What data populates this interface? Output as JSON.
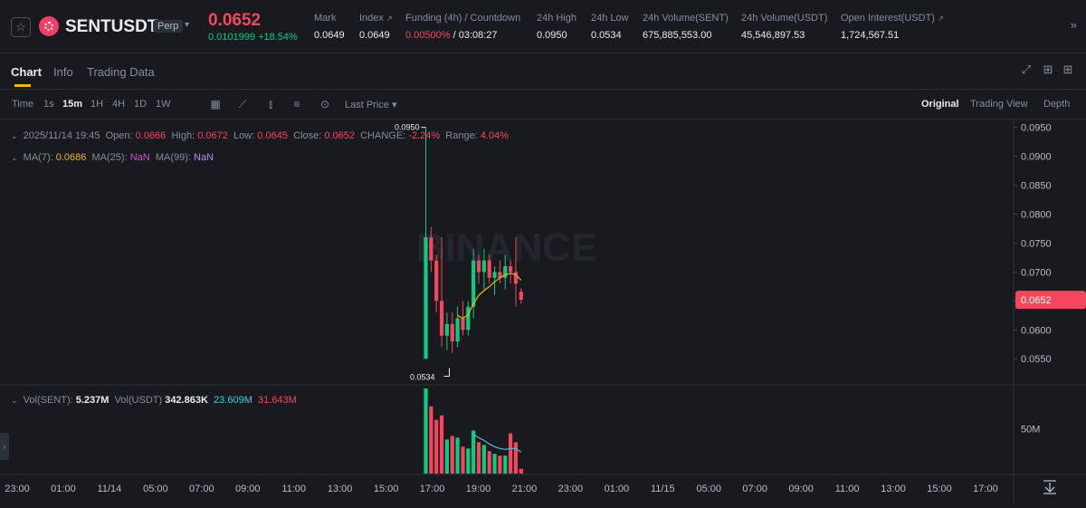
{
  "header": {
    "symbol": "SENTUSDT",
    "contract_type": "Perp",
    "last_price": "0.0652",
    "change_abs": "0.0101999",
    "change_pct": "+18.54%",
    "stats": [
      {
        "label": "Mark",
        "value": "0.0649"
      },
      {
        "label": "Index",
        "value": "0.0649"
      },
      {
        "label": "Funding (4h) / Countdown",
        "value": "0.00500%",
        "value2": "/ 03:08:27"
      },
      {
        "label": "24h High",
        "value": "0.0950"
      },
      {
        "label": "24h Low",
        "value": "0.0534"
      },
      {
        "label": "24h Volume(SENT)",
        "value": "675,885,553.00"
      },
      {
        "label": "24h Volume(USDT)",
        "value": "45,546,897.53"
      },
      {
        "label": "Open Interest(USDT)",
        "value": "1,724,567.51"
      }
    ]
  },
  "tabs": [
    "Chart",
    "Info",
    "Trading Data"
  ],
  "toolbar": {
    "intervals": [
      "Time",
      "1s",
      "15m",
      "1H",
      "4H",
      "1D",
      "1W"
    ],
    "active_interval": "15m",
    "price_type": "Last Price",
    "views": [
      "Original",
      "Trading View",
      "Depth"
    ],
    "active_view": "Original"
  },
  "legend": {
    "date": "2025/11/14 19:45",
    "open_label": "Open:",
    "open": "0.0666",
    "high_label": "High:",
    "high": "0.0672",
    "low_label": "Low:",
    "low": "0.0645",
    "close_label": "Close:",
    "close": "0.0652",
    "change_label": "CHANGE:",
    "change": "-2.24%",
    "range_label": "Range:",
    "range": "4.04%",
    "ma7_label": "MA(7):",
    "ma7": "0.0686",
    "ma25_label": "MA(25):",
    "ma25": "NaN",
    "ma99_label": "MA(99):",
    "ma99": "NaN",
    "vol_label": "Vol(SENT):",
    "vol_sent": "5.237M",
    "volu_label": "Vol(USDT)",
    "vol_usdt": "342.863K",
    "vol_ma1": "23.609M",
    "vol_ma2": "31.643M"
  },
  "watermark": "BINANCE",
  "colors": {
    "up": "#0ecb81",
    "down": "#f6465d",
    "ma7": "#f0b90b",
    "vol_ma": "#5ab8d8",
    "accent": "#f0b90b"
  },
  "chart_data": {
    "type": "candlestick",
    "interval": "15m",
    "price_axis": {
      "ticks": [
        "0.0950",
        "0.0900",
        "0.0850",
        "0.0800",
        "0.0750",
        "0.0700",
        "0.0650",
        "0.0600",
        "0.0550"
      ],
      "min": 0.0505,
      "max": 0.0962
    },
    "current_price_label": "0.0652",
    "high_marker": "0.0950",
    "low_marker": "0.0534",
    "volume_axis": {
      "ticks": [
        "50M"
      ],
      "max": 95
    },
    "x_ticks": [
      "23:00",
      "01:00",
      "11/14",
      "05:00",
      "07:00",
      "09:00",
      "11:00",
      "13:00",
      "15:00",
      "17:00",
      "19:00",
      "21:00",
      "23:00",
      "01:00",
      "11/15",
      "05:00",
      "07:00",
      "09:00",
      "11:00",
      "13:00",
      "15:00",
      "17:00"
    ],
    "candles": [
      {
        "o": 0.055,
        "h": 0.095,
        "l": 0.055,
        "c": 0.076,
        "v": 95
      },
      {
        "o": 0.076,
        "h": 0.0778,
        "l": 0.07,
        "c": 0.072,
        "v": 75
      },
      {
        "o": 0.072,
        "h": 0.073,
        "l": 0.063,
        "c": 0.065,
        "v": 60
      },
      {
        "o": 0.065,
        "h": 0.076,
        "l": 0.057,
        "c": 0.059,
        "v": 65
      },
      {
        "o": 0.059,
        "h": 0.063,
        "l": 0.0565,
        "c": 0.061,
        "v": 38
      },
      {
        "o": 0.061,
        "h": 0.063,
        "l": 0.056,
        "c": 0.058,
        "v": 42
      },
      {
        "o": 0.058,
        "h": 0.064,
        "l": 0.057,
        "c": 0.062,
        "v": 40
      },
      {
        "o": 0.062,
        "h": 0.065,
        "l": 0.059,
        "c": 0.06,
        "v": 30
      },
      {
        "o": 0.06,
        "h": 0.065,
        "l": 0.059,
        "c": 0.064,
        "v": 28
      },
      {
        "o": 0.064,
        "h": 0.074,
        "l": 0.062,
        "c": 0.072,
        "v": 48
      },
      {
        "o": 0.072,
        "h": 0.073,
        "l": 0.068,
        "c": 0.07,
        "v": 35
      },
      {
        "o": 0.07,
        "h": 0.074,
        "l": 0.067,
        "c": 0.072,
        "v": 32
      },
      {
        "o": 0.072,
        "h": 0.073,
        "l": 0.068,
        "c": 0.069,
        "v": 25
      },
      {
        "o": 0.069,
        "h": 0.071,
        "l": 0.066,
        "c": 0.07,
        "v": 22
      },
      {
        "o": 0.07,
        "h": 0.072,
        "l": 0.068,
        "c": 0.069,
        "v": 20
      },
      {
        "o": 0.069,
        "h": 0.073,
        "l": 0.067,
        "c": 0.071,
        "v": 20
      },
      {
        "o": 0.071,
        "h": 0.072,
        "l": 0.068,
        "c": 0.07,
        "v": 45
      },
      {
        "o": 0.07,
        "h": 0.076,
        "l": 0.064,
        "c": 0.068,
        "v": 35
      },
      {
        "o": 0.0666,
        "h": 0.0672,
        "l": 0.0645,
        "c": 0.0652,
        "v": 5.237
      }
    ],
    "ma7": [
      null,
      null,
      null,
      null,
      null,
      null,
      0.0625,
      0.062,
      0.0626,
      0.0645,
      0.066,
      0.0668,
      0.0675,
      0.0683,
      0.069,
      0.0695,
      0.0698,
      0.0695,
      0.0686
    ],
    "vol_ma": [
      null,
      null,
      null,
      null,
      null,
      null,
      null,
      null,
      null,
      44,
      40,
      37,
      33,
      30,
      28,
      27,
      28,
      28,
      24
    ]
  }
}
